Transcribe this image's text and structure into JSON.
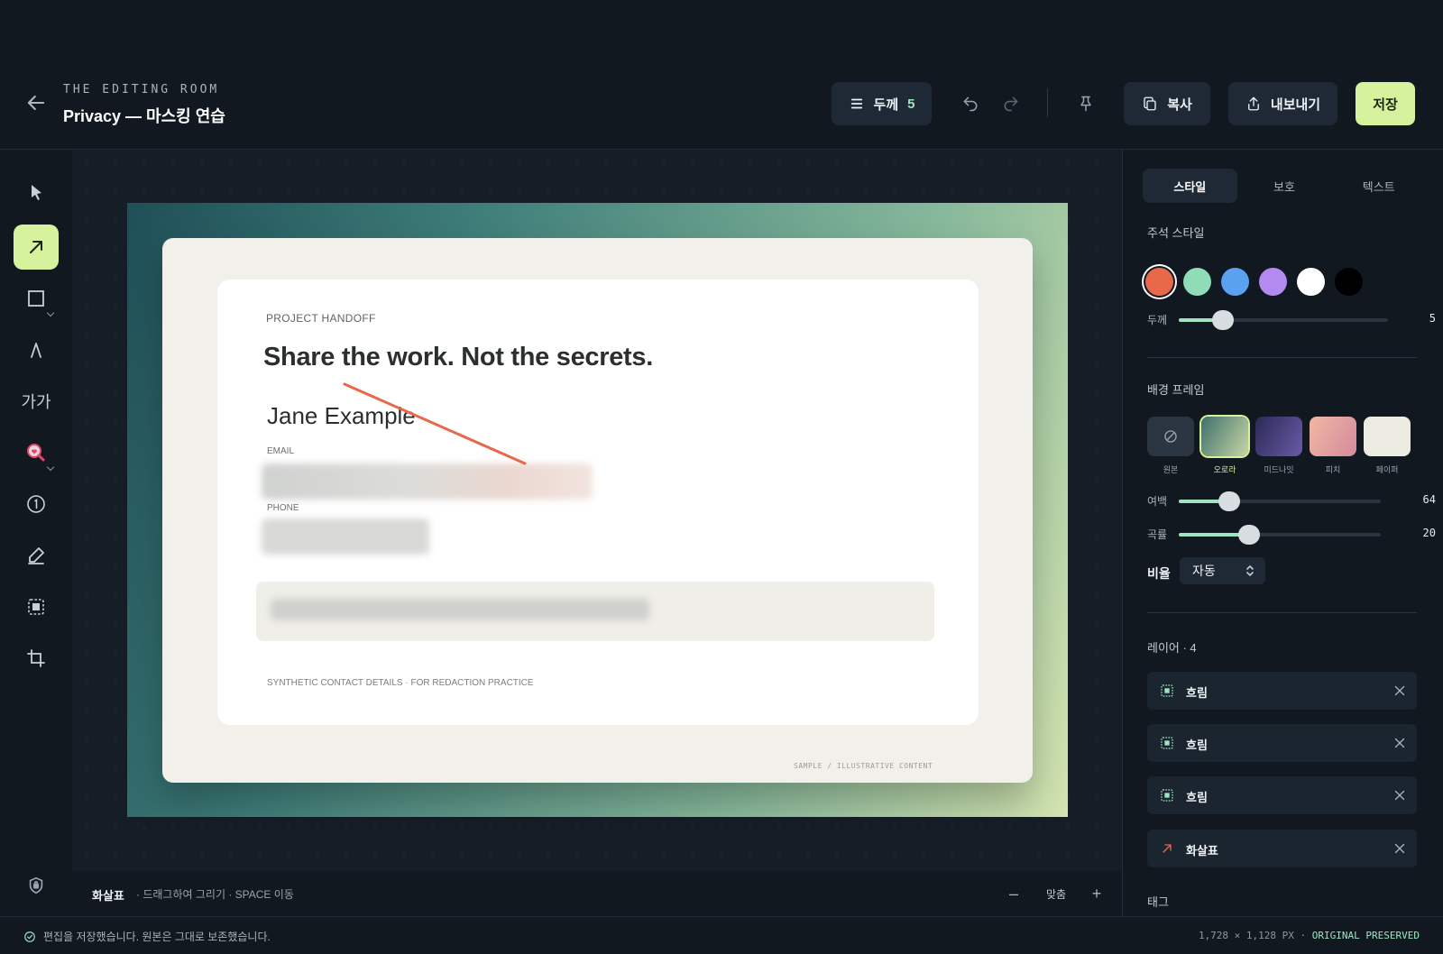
{
  "header": {
    "eyebrow": "THE EDITING ROOM",
    "title": "Privacy — 마스킹 연습",
    "thickness_label": "두께",
    "thickness_value": "5",
    "copy_label": "복사",
    "export_label": "내보내기",
    "save_label": "저장"
  },
  "toolbar": {
    "text_tool_label": "가가"
  },
  "canvas": {
    "card": {
      "eyebrow": "PROJECT HANDOFF",
      "headline": "Share the work. Not the secrets.",
      "name": "Jane Example",
      "email_label": "EMAIL",
      "phone_label": "PHONE",
      "footnote": "SYNTHETIC CONTACT DETAILS · FOR REDACTION PRACTICE"
    },
    "paper_sample": "SAMPLE / ILLUSTRATIVE CONTENT",
    "annotation_color": "#e8684a"
  },
  "canvas_bar": {
    "tool_name": "화살표",
    "hint": "· 드래그하여 그리기 · SPACE 이동",
    "fit_label": "맞춤"
  },
  "status": {
    "message": "편집을 저장했습니다. 원본은 그대로 보존했습니다.",
    "dimensions": "1,728 × 1,128 PX · ",
    "preserved": "ORIGINAL PRESERVED"
  },
  "panel": {
    "tabs": [
      "스타일",
      "보호",
      "텍스트"
    ],
    "annotation_style_label": "주석 스타일",
    "colors": [
      "#e8684a",
      "#8fdcb8",
      "#5aa2f0",
      "#b38af0",
      "#ffffff",
      "#000000"
    ],
    "selected_color": "#e8684a",
    "thickness_label": "두께",
    "thickness_value": "5",
    "thickness_fraction": 0.21,
    "bg_frame_label": "배경 프레임",
    "bg_frames": [
      "원본",
      "오로라",
      "미드나잇",
      "피치",
      "페이퍼"
    ],
    "bg_selected": "오로라",
    "padding_label": "여백",
    "padding_value": "64",
    "padding_fraction": 0.25,
    "radius_label": "곡률",
    "radius_value": "20",
    "radius_fraction": 0.35,
    "ratio_label": "비율",
    "ratio_value": "자동",
    "layers_label": "레이어 · 4",
    "layers": [
      "흐림",
      "흐림",
      "흐림",
      "화살표"
    ],
    "tags_label": "태그"
  }
}
